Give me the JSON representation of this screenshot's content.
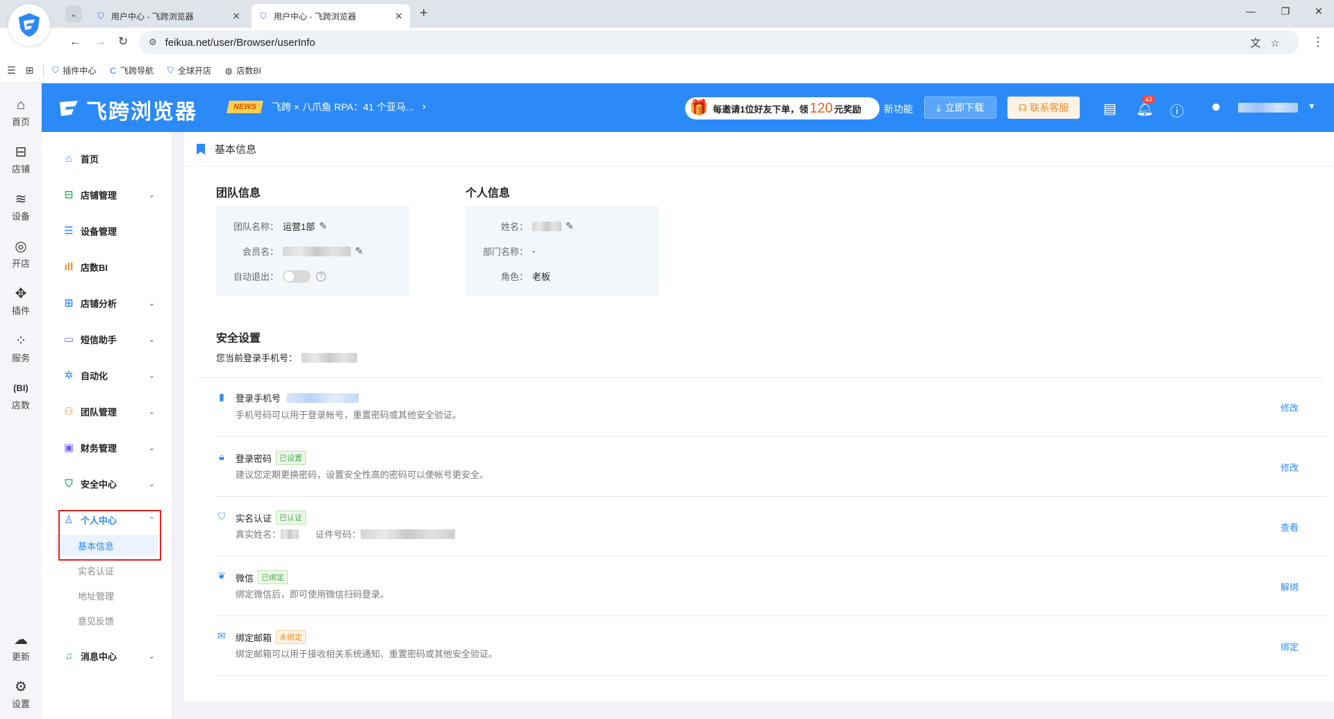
{
  "browser": {
    "tabs": [
      {
        "title": "用户中心 - 飞跨浏览器",
        "active": false
      },
      {
        "title": "用户中心 - 飞跨浏览器",
        "active": true
      }
    ],
    "url": "feikua.net/user/Browser/userInfo",
    "bookmarks": [
      {
        "label": "插件中心",
        "icon": "shield-icon"
      },
      {
        "label": "飞跨导航",
        "icon": "c-logo-icon"
      },
      {
        "label": "全球开店",
        "icon": "shield-icon"
      },
      {
        "label": "店数BI",
        "icon": "globe-icon"
      }
    ]
  },
  "rail": {
    "items": [
      {
        "label": "首页",
        "icon": "home-icon"
      },
      {
        "label": "店铺",
        "icon": "store-icon"
      },
      {
        "label": "设备",
        "icon": "layers-icon"
      },
      {
        "label": "开店",
        "icon": "planet-icon"
      },
      {
        "label": "插件",
        "icon": "puzzle-icon"
      },
      {
        "label": "服务",
        "icon": "grid-icon"
      },
      {
        "label": "店数",
        "icon": "bi-icon"
      },
      {
        "label": "更新",
        "icon": "cloud-upload-icon"
      },
      {
        "label": "设置",
        "icon": "settings-icon"
      }
    ]
  },
  "header": {
    "brand": "飞跨浏览器",
    "news_badge": "NEWS",
    "news_text": "飞跨 × 八爪鱼 RPA：41 个亚马...",
    "invite_prefix": "每邀请1位好友下单，领",
    "invite_number": "120",
    "invite_suffix": "元奖励",
    "new_features": "新功能",
    "download": "立即下载",
    "service": "联系客服",
    "notification_count": "43"
  },
  "sidebar": {
    "items": [
      {
        "label": "首页",
        "icon": "home-icon",
        "arrow": false
      },
      {
        "label": "店铺管理",
        "icon": "store-icon",
        "arrow": true
      },
      {
        "label": "设备管理",
        "icon": "server-icon",
        "arrow": false
      },
      {
        "label": "店数BI",
        "icon": "bar-chart-icon",
        "arrow": false
      },
      {
        "label": "店铺分析",
        "icon": "grid-icon",
        "arrow": true
      },
      {
        "label": "短信助手",
        "icon": "message-icon",
        "arrow": true
      },
      {
        "label": "自动化",
        "icon": "gear-icon",
        "arrow": true
      },
      {
        "label": "团队管理",
        "icon": "team-icon",
        "arrow": true
      },
      {
        "label": "财务管理",
        "icon": "wallet-icon",
        "arrow": true
      },
      {
        "label": "安全中心",
        "icon": "shield-check-icon",
        "arrow": true
      },
      {
        "label": "个人中心",
        "icon": "user-icon",
        "arrow": true,
        "open": true
      }
    ],
    "sub_items": [
      {
        "label": "基本信息",
        "active": true
      },
      {
        "label": "实名认证",
        "active": false
      },
      {
        "label": "地址管理",
        "active": false
      },
      {
        "label": "意见反馈",
        "active": false
      }
    ],
    "footer_item": {
      "label": "消息中心",
      "icon": "bell-icon"
    }
  },
  "main": {
    "page_title": "基本信息",
    "team": {
      "title": "团队信息",
      "name_label": "团队名称：",
      "name_value": "运营1部",
      "member_label": "会员名：",
      "auto_logout_label": "自动退出："
    },
    "personal": {
      "title": "个人信息",
      "name_label": "姓名：",
      "dept_label": "部门名称：",
      "dept_value": "-",
      "role_label": "角色：",
      "role_value": "老板"
    },
    "security": {
      "title": "安全设置",
      "current_phone_label": "您当前登录手机号：",
      "rows": [
        {
          "icon": "phone-icon",
          "name": "登录手机号",
          "tag": "",
          "desc": "手机号码可以用于登录帐号，重置密码或其他安全验证。",
          "action": "修改"
        },
        {
          "icon": "lock-icon",
          "name": "登录密码",
          "tag": "已设置",
          "tag_color": "green",
          "desc": "建议您定期更换密码，设置安全性高的密码可以使帐号更安全。",
          "action": "修改"
        },
        {
          "icon": "verified-icon",
          "name": "实名认证",
          "tag": "已认证",
          "tag_color": "green",
          "desc_real_name_label": "真实姓名：",
          "desc_id_label": "证件号码：",
          "action": "查看"
        },
        {
          "icon": "wechat-icon",
          "name": "微信",
          "tag": "已绑定",
          "tag_color": "green",
          "desc": "绑定微信后，即可使用微信扫码登录。",
          "action": "解绑"
        },
        {
          "icon": "mail-icon",
          "name": "绑定邮箱",
          "tag": "未绑定",
          "tag_color": "orange",
          "desc": "绑定邮箱可以用于接收相关系统通知、重置密码或其他安全验证。",
          "action": "绑定"
        }
      ]
    }
  }
}
